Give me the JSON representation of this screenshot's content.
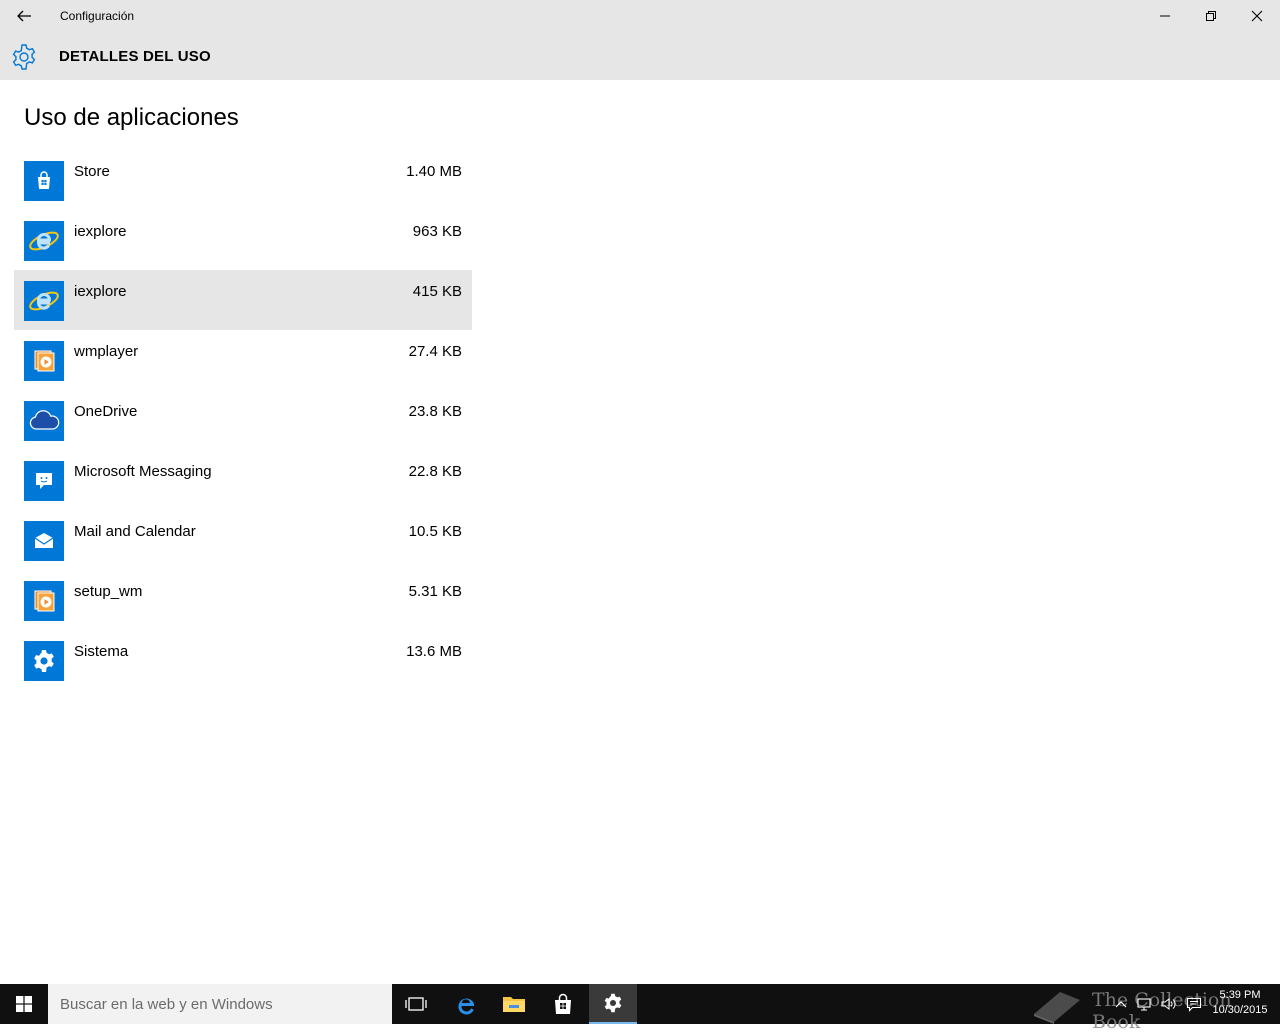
{
  "window": {
    "title": "Configuración",
    "controls": [
      "minimize",
      "maximize",
      "close"
    ]
  },
  "header": {
    "title": "DETALLES DEL USO",
    "icon": "gear-icon"
  },
  "section": {
    "title": "Uso de aplicaciones"
  },
  "apps": [
    {
      "name": "Store",
      "size": "1.40 MB",
      "icon": "store-icon"
    },
    {
      "name": "iexplore",
      "size": "963 KB",
      "icon": "internet-explorer-icon"
    },
    {
      "name": "iexplore",
      "size": "415 KB",
      "icon": "internet-explorer-icon"
    },
    {
      "name": "wmplayer",
      "size": "27.4 KB",
      "icon": "media-player-icon"
    },
    {
      "name": "OneDrive",
      "size": "23.8 KB",
      "icon": "cloud-icon"
    },
    {
      "name": "Microsoft Messaging",
      "size": "22.8 KB",
      "icon": "messaging-icon"
    },
    {
      "name": "Mail and Calendar",
      "size": "10.5 KB",
      "icon": "mail-icon"
    },
    {
      "name": "setup_wm",
      "size": "5.31 KB",
      "icon": "media-player-icon"
    },
    {
      "name": "Sistema",
      "size": "13.6 MB",
      "icon": "gear-icon"
    }
  ],
  "selected_index": 2,
  "taskbar": {
    "search_placeholder": "Buscar en la web y en Windows",
    "watermark": "The Collection Book",
    "time": "5:39 PM",
    "date": "10/30/2015"
  },
  "colors": {
    "accent": "#0078d7",
    "chrome": "#e6e6e6",
    "taskbar": "#101010"
  }
}
